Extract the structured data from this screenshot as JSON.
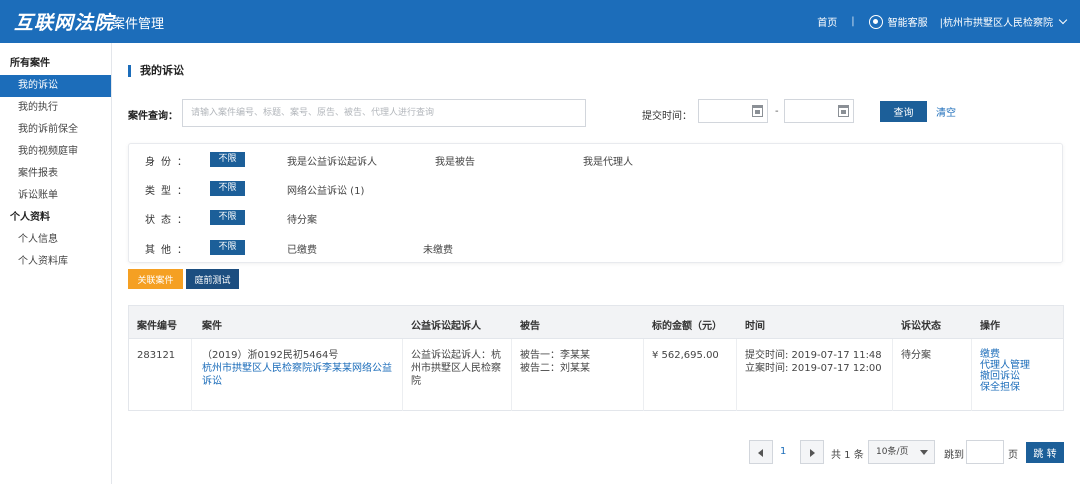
{
  "header": {
    "logo": "互联网法院",
    "app_title": "案件管理",
    "home": "首页",
    "separator": "|",
    "assistant": "智能客服",
    "org": "|杭州市拱墅区人民检察院"
  },
  "sidebar": {
    "group1": "所有案件",
    "items1": [
      "我的诉讼",
      "我的执行",
      "我的诉前保全",
      "我的视频庭审",
      "案件报表",
      "诉讼账单"
    ],
    "group2": "个人资料",
    "items2": [
      "个人信息",
      "个人资料库"
    ]
  },
  "main": {
    "title": "我的诉讼",
    "search_label": "案件查询：",
    "search_placeholder": "请输入案件编号、标题、案号、原告、被告、代理人进行查询",
    "date_label": "提交时间：",
    "date_dash": "-",
    "query_button": "查询",
    "clear_link": "清空"
  },
  "filters": {
    "unlimited": "不限",
    "identity_label": "身份：",
    "identity_options": [
      "我是公益诉讼起诉人",
      "我是被告",
      "我是代理人"
    ],
    "type_label": "类型：",
    "type_options": [
      "网络公益诉讼 (1)"
    ],
    "status_label": "状态：",
    "status_options": [
      "待分案"
    ],
    "other_label": "其他：",
    "other_options": [
      "已缴费",
      "未缴费"
    ]
  },
  "actions": {
    "link_case": "关联案件",
    "court_test": "庭前测试"
  },
  "table": {
    "headers": [
      "案件编号",
      "案件",
      "公益诉讼起诉人",
      "被告",
      "标的金额（元）",
      "时间",
      "诉讼状态",
      "操作"
    ],
    "row": {
      "id": "283121",
      "case_no": "（2019）浙0192民初5464号",
      "case_title": "杭州市拱墅区人民检察院诉李某某网络公益诉讼",
      "plaintiff": "公益诉讼起诉人：杭州市拱墅区人民检察院",
      "defendant1": "被告一：李某某",
      "defendant2": "被告二：刘某某",
      "amount": "¥ 562,695.00",
      "submit_time": "提交时间: 2019-07-17 11:48",
      "filing_time": "立案时间: 2019-07-17 12:00",
      "status": "待分案",
      "ops": [
        "缴费",
        "代理人管理",
        "撤回诉讼",
        "保全担保"
      ]
    }
  },
  "pager": {
    "page": "1",
    "total": "共 1 条",
    "page_size": "10条/页",
    "jump_label": "跳到",
    "page_unit": "页",
    "go": "跳 转"
  }
}
